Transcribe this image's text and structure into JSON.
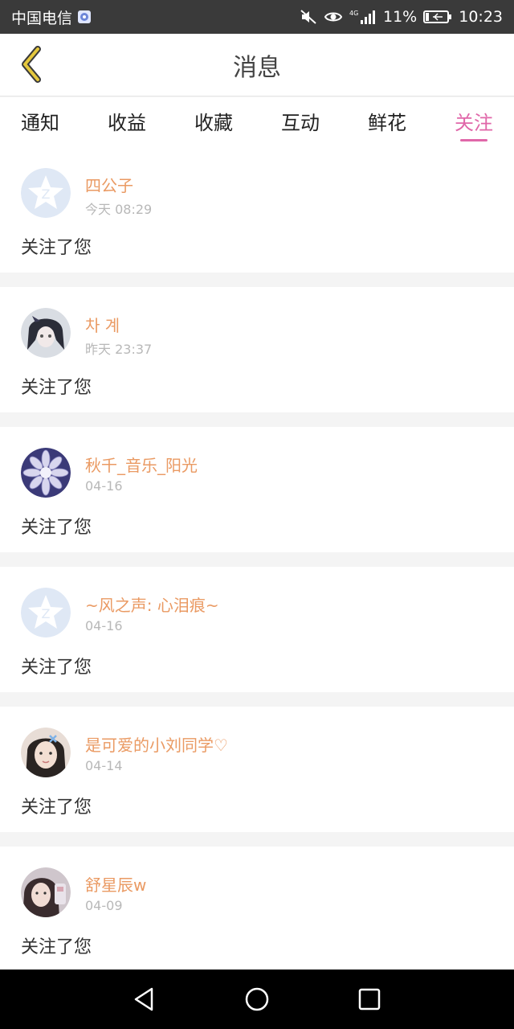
{
  "status_bar": {
    "carrier": "中国电信",
    "battery": "11%",
    "time": "10:23"
  },
  "header": {
    "title": "消息"
  },
  "tabs": [
    {
      "label": "通知",
      "active": false
    },
    {
      "label": "收益",
      "active": false
    },
    {
      "label": "收藏",
      "active": false
    },
    {
      "label": "互动",
      "active": false
    },
    {
      "label": "鲜花",
      "active": false
    },
    {
      "label": "关注",
      "active": true
    }
  ],
  "colors": {
    "accent": "#e067a9",
    "name": "#ea9a63",
    "back": "#e5c83d"
  },
  "items": [
    {
      "name": "四公子",
      "time": "今天 08:29",
      "action": "关注了您",
      "avatar": "default-qzone-icon"
    },
    {
      "name": "차 계",
      "time": "昨天 23:37",
      "action": "关注了您",
      "avatar": "anime-girl-avatar"
    },
    {
      "name": "秋千_音乐_阳光",
      "time": "04-16",
      "action": "关注了您",
      "avatar": "flower-avatar"
    },
    {
      "name": "~风之声: 心泪痕~",
      "time": "04-16",
      "action": "关注了您",
      "avatar": "default-qzone-icon"
    },
    {
      "name": "是可爱的小刘同学♡",
      "time": "04-14",
      "action": "关注了您",
      "avatar": "girl-photo-avatar"
    },
    {
      "name": "舒星辰w",
      "time": "04-09",
      "action": "关注了您",
      "avatar": "girl-selfie-avatar"
    }
  ]
}
